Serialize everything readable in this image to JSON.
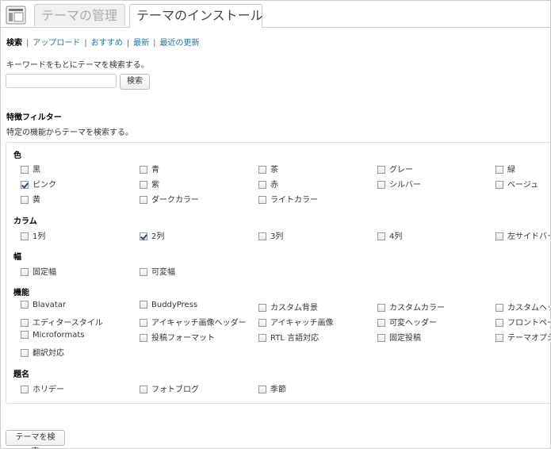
{
  "tabs": [
    {
      "label": "テーマの管理",
      "active": false
    },
    {
      "label": "テーマのインストール",
      "active": true
    }
  ],
  "subnav": [
    {
      "label": "検索",
      "current": true
    },
    {
      "label": "アップロード",
      "current": false
    },
    {
      "label": "おすすめ",
      "current": false
    },
    {
      "label": "最新",
      "current": false
    },
    {
      "label": "最近の更新",
      "current": false
    }
  ],
  "search": {
    "hint": "キーワードをもとにテーマを検索する。",
    "value": "",
    "button_label": "検索"
  },
  "feature_filter": {
    "title": "特徴フィルター",
    "description": "特定の機能からテーマを検索する。",
    "groups": [
      {
        "title": "色",
        "options": [
          {
            "label": "黒",
            "checked": false
          },
          {
            "label": "青",
            "checked": false
          },
          {
            "label": "茶",
            "checked": false
          },
          {
            "label": "グレー",
            "checked": false
          },
          {
            "label": "緑",
            "checked": false
          },
          {
            "label": "ピンク",
            "checked": true
          },
          {
            "label": "紫",
            "checked": false
          },
          {
            "label": "赤",
            "checked": false
          },
          {
            "label": "シルバー",
            "checked": false
          },
          {
            "label": "ベージュ",
            "checked": false
          },
          {
            "label": "黄",
            "checked": false
          },
          {
            "label": "ダークカラー",
            "checked": false
          },
          {
            "label": "ライトカラー",
            "checked": false
          }
        ]
      },
      {
        "title": "カラム",
        "options": [
          {
            "label": "1列",
            "checked": false
          },
          {
            "label": "2列",
            "checked": true
          },
          {
            "label": "3列",
            "checked": false
          },
          {
            "label": "4列",
            "checked": false
          },
          {
            "label": "左サイドバー",
            "checked": false
          }
        ]
      },
      {
        "title": "幅",
        "options": [
          {
            "label": "固定幅",
            "checked": false
          },
          {
            "label": "可変幅",
            "checked": false
          }
        ]
      },
      {
        "title": "機能",
        "options": [
          {
            "label": "Blavatar",
            "checked": false
          },
          {
            "label": "BuddyPress",
            "checked": false
          },
          {
            "label": "カスタム背景",
            "checked": false
          },
          {
            "label": "カスタムカラー",
            "checked": false
          },
          {
            "label": "カスタムヘッダ",
            "checked": false
          },
          {
            "label": "エディタースタイル",
            "checked": false
          },
          {
            "label": "アイキャッチ画像ヘッダー",
            "checked": false
          },
          {
            "label": "アイキャッチ画像",
            "checked": false
          },
          {
            "label": "可変ヘッダー",
            "checked": false
          },
          {
            "label": "フロントページ",
            "checked": false
          },
          {
            "label": "Microformats",
            "checked": false
          },
          {
            "label": "投稿フォーマット",
            "checked": false
          },
          {
            "label": "RTL 言語対応",
            "checked": false
          },
          {
            "label": "固定投稿",
            "checked": false
          },
          {
            "label": "テーマオプシ",
            "checked": false
          },
          {
            "label": "翻訳対応",
            "checked": false
          }
        ]
      },
      {
        "title": "題名",
        "options": [
          {
            "label": "ホリデー",
            "checked": false
          },
          {
            "label": "フォトブログ",
            "checked": false
          },
          {
            "label": "季節",
            "checked": false
          }
        ]
      }
    ]
  },
  "submit_label": "テーマを検索",
  "icons": {
    "header": "theme-layout-icon",
    "checkbox_checked": "checkmark-icon"
  }
}
